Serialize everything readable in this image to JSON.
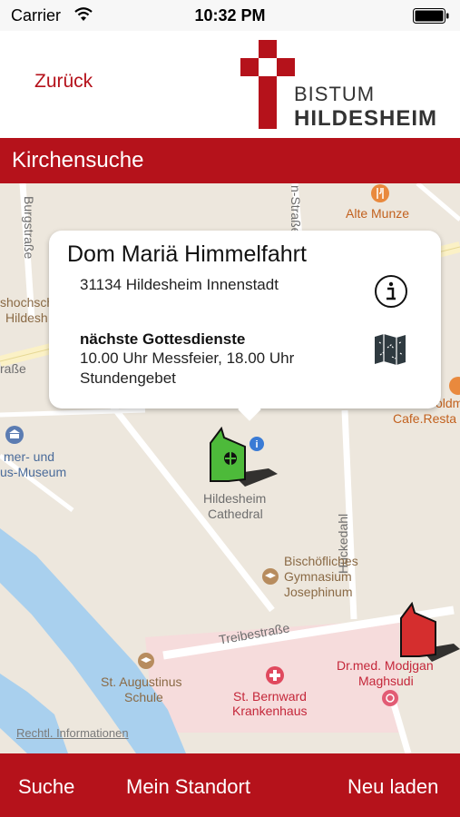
{
  "status_bar": {
    "carrier": "Carrier",
    "time": "10:32 PM"
  },
  "header": {
    "back_label": "Zurück",
    "logo_line1": "BISTUM",
    "logo_line2": "HILDESHEIM",
    "brand_color": "#b5121b"
  },
  "section": {
    "title": "Kirchensuche"
  },
  "map": {
    "labels": {
      "burgstrasse": "Burgstraße",
      "n_strasse": "n-Straße",
      "alte_munze": "Alte Munze",
      "hochschule_1": "shochsch",
      "hochschule_2": "Hildesh",
      "strasse_left": "raße",
      "cafe": "Cafe.Resta",
      "oldm": "oldm",
      "museum_1": "mer- und",
      "museum_2": "us-Museum",
      "cathedral_1": "Hildesheim",
      "cathedral_2": "Cathedral",
      "huckedahl": "Hückedahl",
      "gymnasium_1": "Bischöfliches",
      "gymnasium_2": "Gymnasium",
      "gymnasium_3": "Josephinum",
      "treibestrasse": "Treibestraße",
      "doctor_1": "Dr.med. Modjgan",
      "doctor_2": "Maghsudi",
      "augustinus_1": "St. Augustinus",
      "augustinus_2": "Schule",
      "krankenhaus_1": "St. Bernward",
      "krankenhaus_2": "Krankenhaus"
    },
    "legal_link": "Rechtl. Informationen"
  },
  "callout": {
    "title": "Dom Mariä Himmelfahrt",
    "address": "31134 Hildesheim Innenstadt",
    "services_heading": "nächste Gottesdienste",
    "services_text": "10.00 Uhr Messfeier, 18.00 Uhr Stundengebet",
    "info_icon": "info-icon",
    "map_icon": "map-icon"
  },
  "bottom_bar": {
    "search_label": "Suche",
    "location_label": "Mein Standort",
    "reload_label": "Neu laden"
  }
}
